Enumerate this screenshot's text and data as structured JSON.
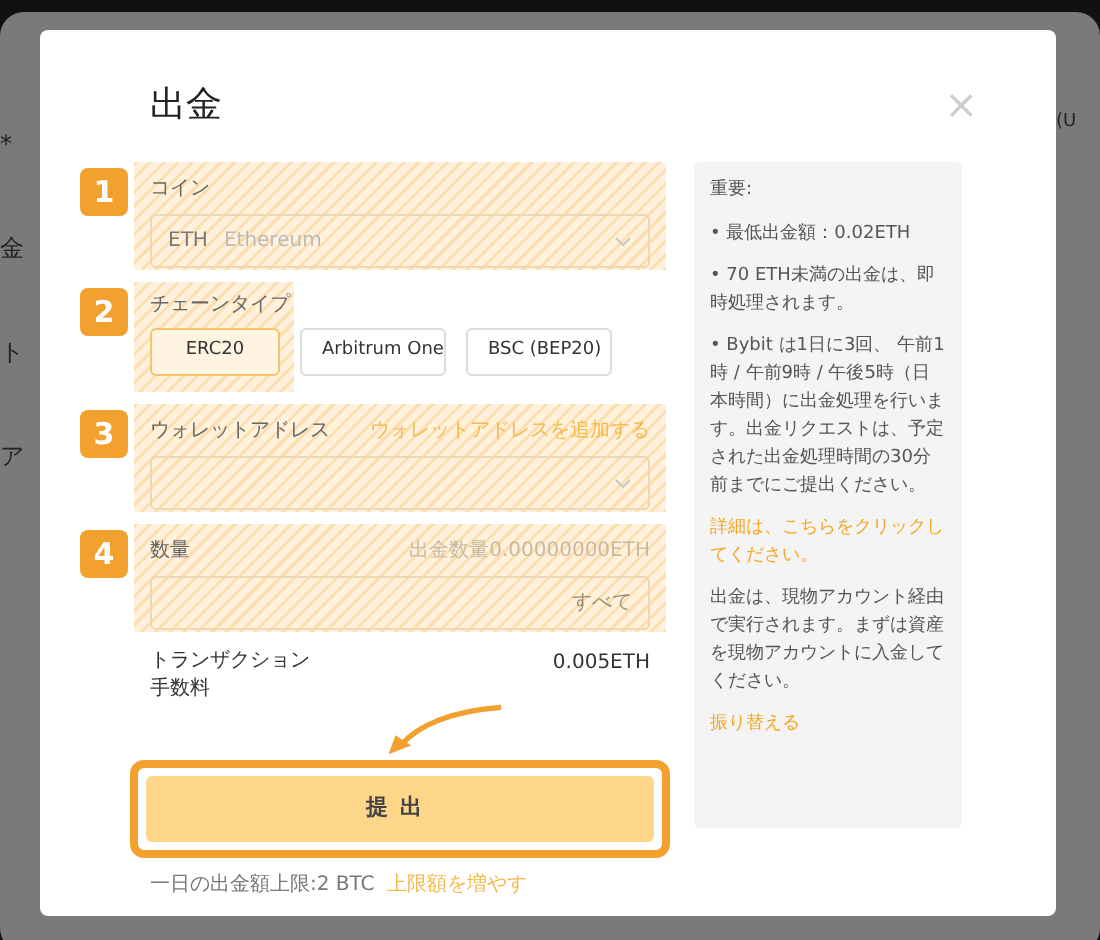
{
  "background": {
    "left_fragments": [
      "*",
      "金",
      "ト",
      "ア"
    ],
    "right_fragment": "(U"
  },
  "dialog": {
    "title": "出金",
    "close": "×"
  },
  "steps": [
    {
      "number": "1",
      "kind": "select",
      "label": "コイン",
      "value_code": "ETH",
      "value_name": "Ethereum"
    },
    {
      "number": "2",
      "kind": "chips",
      "label": "チェーンタイプ",
      "options": [
        {
          "label": "ERC20",
          "selected": true
        },
        {
          "label": "Arbitrum One",
          "selected": false
        },
        {
          "label": "BSC (BEP20)",
          "selected": false
        }
      ]
    },
    {
      "number": "3",
      "kind": "select",
      "label": "ウォレットアドレス",
      "link": "ウォレットアドレスを追加する"
    },
    {
      "number": "4",
      "kind": "amount",
      "label": "数量",
      "hint": "出金数量0.00000000ETH",
      "all_button": "すべて"
    }
  ],
  "fee": {
    "label_line1": "トランザクション",
    "label_line2": "手数料",
    "value": "0.005ETH"
  },
  "submit": "提出",
  "daily_limit": {
    "text": "一日の出金額上限:2 BTC",
    "link": "上限額を増やす"
  },
  "notice": {
    "heading": "重要:",
    "items": [
      {
        "kind": "text",
        "text": "• 最低出金額：0.02ETH"
      },
      {
        "kind": "text",
        "text": "• 70 ETH未満の出金は、即時処理されます。"
      },
      {
        "kind": "text",
        "text": "• Bybit は1日に3回、 午前1時 / 午前9時 / 午後5時（日本時間）に出金処理を行います。出金リクエストは、予定された出金処理時間の30分前までにご提出ください。"
      },
      {
        "kind": "link",
        "text": "詳細は、こちらをクリックしてください。"
      },
      {
        "kind": "text",
        "text": "出金は、現物アカウント経由で実行されます。まずは資産を現物アカウントに入金してください。"
      },
      {
        "kind": "link",
        "text": "振り替える"
      }
    ]
  }
}
